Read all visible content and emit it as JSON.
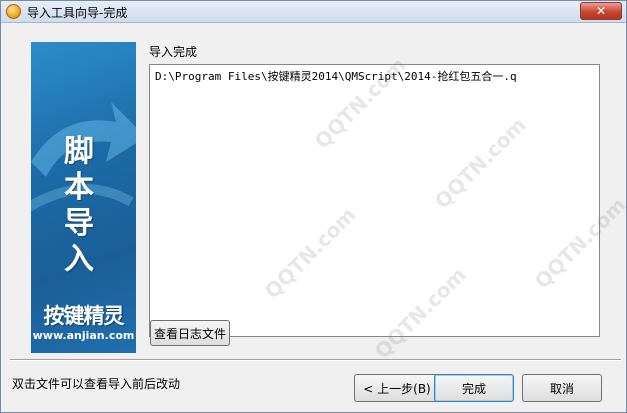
{
  "window": {
    "title": "导入工具向导-完成",
    "close_label": "✕"
  },
  "banner": {
    "vertical_chars": [
      "脚",
      "本",
      "导",
      "入"
    ],
    "brand": "按键精灵",
    "url": "www.anjian.com"
  },
  "main": {
    "section_label": "导入完成",
    "paths": [
      "D:\\Program Files\\按键精灵2014\\QMScript\\2014-抢红包五合一.q"
    ],
    "view_log_label": "查看日志文件"
  },
  "footer": {
    "hint": "双击文件可以查看导入前后改动",
    "back_label": "< 上一步(B)",
    "finish_label": "完成",
    "cancel_label": "取消"
  },
  "watermark": {
    "text": "QQTN.com"
  }
}
